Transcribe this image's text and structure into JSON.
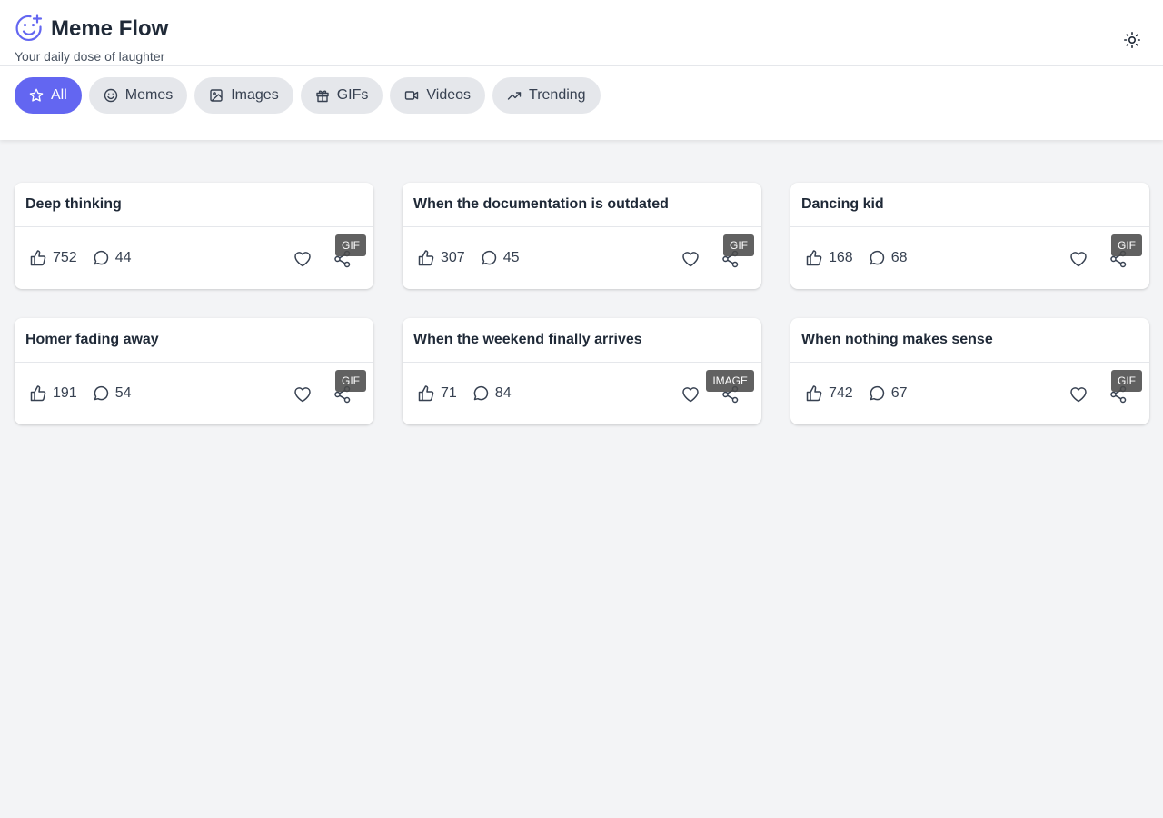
{
  "app": {
    "title": "Meme Flow",
    "tagline": "Your daily dose of laughter",
    "logo_icon": "smile-plus-icon",
    "theme_icon": "sun-icon",
    "accent_color": "#6366f1"
  },
  "tabs": [
    {
      "label": "All",
      "icon": "star-icon",
      "active": true
    },
    {
      "label": "Memes",
      "icon": "smile-icon",
      "active": false
    },
    {
      "label": "Images",
      "icon": "image-icon",
      "active": false
    },
    {
      "label": "GIFs",
      "icon": "gift-icon",
      "active": false
    },
    {
      "label": "Videos",
      "icon": "video-icon",
      "active": false
    },
    {
      "label": "Trending",
      "icon": "trending-up-icon",
      "active": false
    }
  ],
  "posts": [
    {
      "title": "Deep thinking",
      "likes": "752",
      "comments": "44",
      "type": "GIF"
    },
    {
      "title": "When the documentation is outdated",
      "likes": "307",
      "comments": "45",
      "type": "GIF"
    },
    {
      "title": "Dancing kid",
      "likes": "168",
      "comments": "68",
      "type": "GIF"
    },
    {
      "title": "Homer fading away",
      "likes": "191",
      "comments": "54",
      "type": "GIF"
    },
    {
      "title": "When the weekend finally arrives",
      "likes": "71",
      "comments": "84",
      "type": "IMAGE"
    },
    {
      "title": "When nothing makes sense",
      "likes": "742",
      "comments": "67",
      "type": "GIF"
    }
  ]
}
